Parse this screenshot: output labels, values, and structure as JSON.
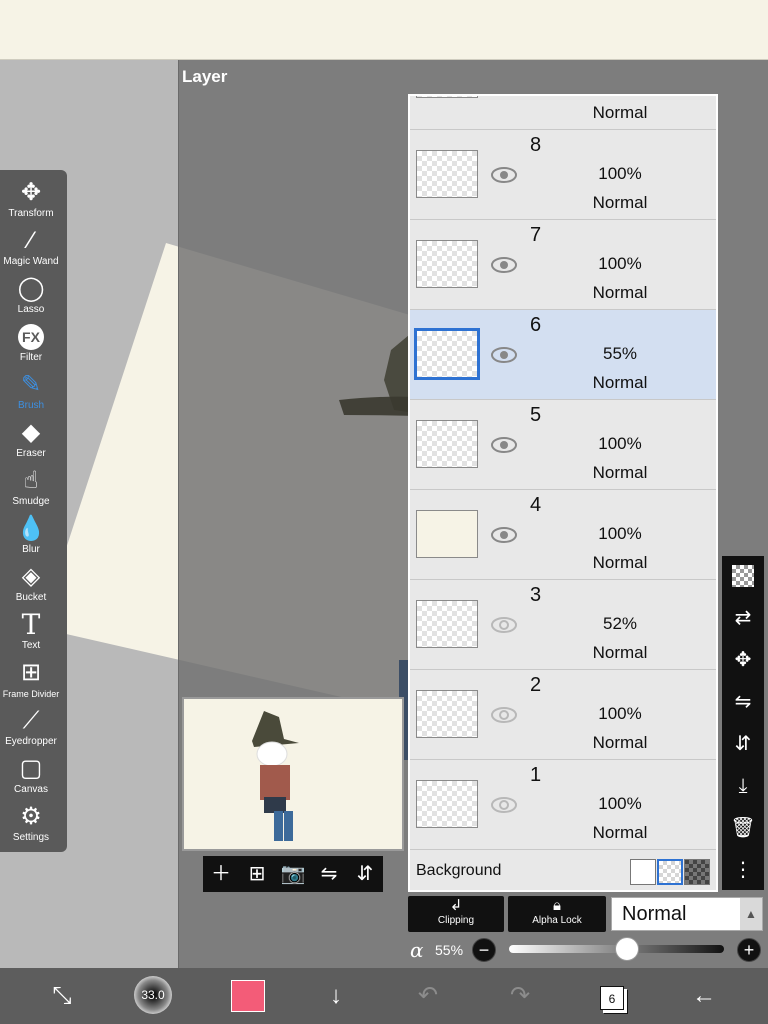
{
  "panel": {
    "title": "Layer"
  },
  "toolbar": {
    "tools": [
      {
        "label": "Transform",
        "icon": "move-icon"
      },
      {
        "label": "Magic Wand",
        "icon": "magic-wand-icon"
      },
      {
        "label": "Lasso",
        "icon": "lasso-icon"
      },
      {
        "label": "Filter",
        "icon": "fx-icon"
      },
      {
        "label": "Brush",
        "icon": "brush-icon",
        "active": true
      },
      {
        "label": "Eraser",
        "icon": "eraser-icon"
      },
      {
        "label": "Smudge",
        "icon": "smudge-icon"
      },
      {
        "label": "Blur",
        "icon": "drop-icon"
      },
      {
        "label": "Bucket",
        "icon": "bucket-icon"
      },
      {
        "label": "Text",
        "icon": "text-icon"
      },
      {
        "label": "Frame Divider",
        "icon": "frame-divider-icon"
      },
      {
        "label": "Eyedropper",
        "icon": "eyedropper-icon"
      },
      {
        "label": "Canvas",
        "icon": "canvas-icon"
      },
      {
        "label": "Settings",
        "icon": "gear-icon"
      }
    ],
    "active_color": "#3d8fe0"
  },
  "layers": {
    "top_partial_mode": "Normal",
    "rows": [
      {
        "number": "8",
        "opacity": "100%",
        "mode": "Normal",
        "visible": true,
        "selected": false
      },
      {
        "number": "7",
        "opacity": "100%",
        "mode": "Normal",
        "visible": true,
        "selected": false
      },
      {
        "number": "6",
        "opacity": "55%",
        "mode": "Normal",
        "visible": true,
        "selected": true
      },
      {
        "number": "5",
        "opacity": "100%",
        "mode": "Normal",
        "visible": true,
        "selected": false
      },
      {
        "number": "4",
        "opacity": "100%",
        "mode": "Normal",
        "visible": true,
        "selected": false
      },
      {
        "number": "3",
        "opacity": "52%",
        "mode": "Normal",
        "visible": false,
        "selected": false
      },
      {
        "number": "2",
        "opacity": "100%",
        "mode": "Normal",
        "visible": false,
        "selected": false
      },
      {
        "number": "1",
        "opacity": "100%",
        "mode": "Normal",
        "visible": false,
        "selected": false
      }
    ],
    "background_label": "Background",
    "selected_color": "#d3dff1"
  },
  "controls": {
    "clipping_label": "Clipping",
    "alpha_lock_label": "Alpha Lock",
    "blend_mode": "Normal",
    "alpha_symbol": "α",
    "opacity_label": "55%",
    "opacity_value": 0.55
  },
  "bottom": {
    "brush_size": "33.0",
    "color": "#f35c78",
    "layer_count": "6"
  }
}
